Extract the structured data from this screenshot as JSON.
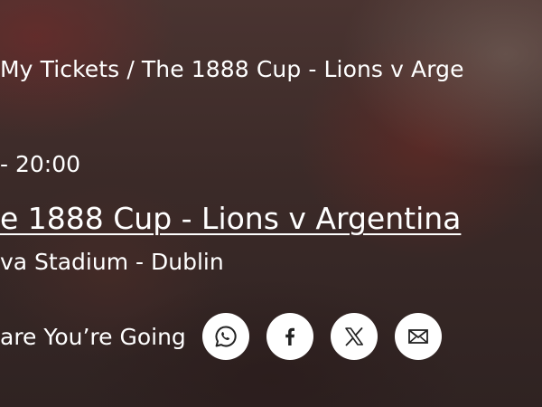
{
  "breadcrumb": "My Tickets / The 1888 Cup - Lions v Arge",
  "event": {
    "datetime": "- 20:00",
    "title": "e 1888 Cup - Lions v Argentina",
    "venue": "va Stadium - Dublin"
  },
  "share": {
    "label": "are You’re Going",
    "buttons": [
      {
        "icon": "whatsapp-icon"
      },
      {
        "icon": "facebook-icon"
      },
      {
        "icon": "x-twitter-icon"
      },
      {
        "icon": "email-icon"
      }
    ]
  },
  "colors": {
    "text": "#ffffff",
    "button_bg": "#ffffff",
    "icon": "#222222"
  }
}
